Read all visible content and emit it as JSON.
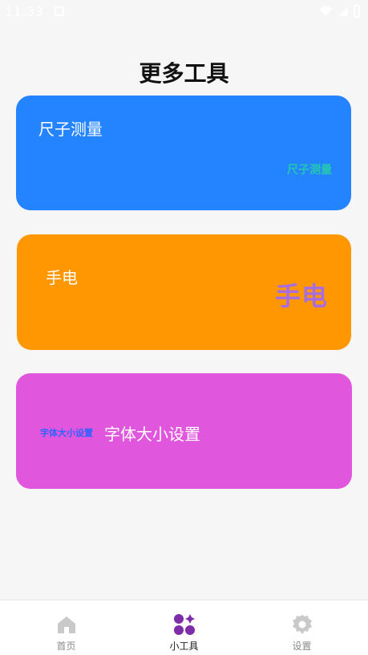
{
  "status_bar": {
    "time": "11:33"
  },
  "header": {
    "title": "更多工具"
  },
  "cards": {
    "ruler": {
      "title": "尺子测量",
      "logo": "尺子测量",
      "color": "#2484ff"
    },
    "flash": {
      "title": "手电",
      "logo": "手电",
      "color": "#ff9702"
    },
    "font": {
      "title": "字体大小设置",
      "logo": "字体大小设置",
      "color": "#e056dc"
    }
  },
  "bottom_nav": {
    "items": [
      {
        "label": "首页",
        "icon": "home-icon",
        "active": false
      },
      {
        "label": "小工具",
        "icon": "tools-icon",
        "active": true,
        "color": "#7e2ca8"
      },
      {
        "label": "设置",
        "icon": "gear-icon",
        "active": false
      }
    ]
  }
}
